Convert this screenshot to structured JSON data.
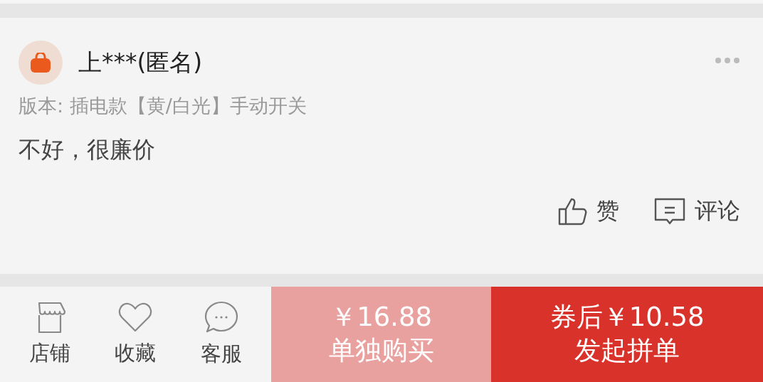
{
  "review": {
    "user_name": "上***(匿名)",
    "version": "版本: 插电款【黄/白光】手动开关",
    "text": "不好，很廉价",
    "actions": [
      {
        "kind": "like",
        "label": "赞"
      },
      {
        "kind": "comment",
        "label": "评论"
      }
    ]
  },
  "bottom_bar": {
    "nav": [
      {
        "kind": "store",
        "label": "店铺"
      },
      {
        "kind": "favorite",
        "label": "收藏"
      },
      {
        "kind": "service",
        "label": "客服"
      }
    ],
    "buttons": [
      {
        "kind": "solo",
        "price": "￥16.88",
        "label": "单独购买"
      },
      {
        "kind": "group",
        "price": "券后￥10.58",
        "label": "发起拼单"
      }
    ]
  }
}
